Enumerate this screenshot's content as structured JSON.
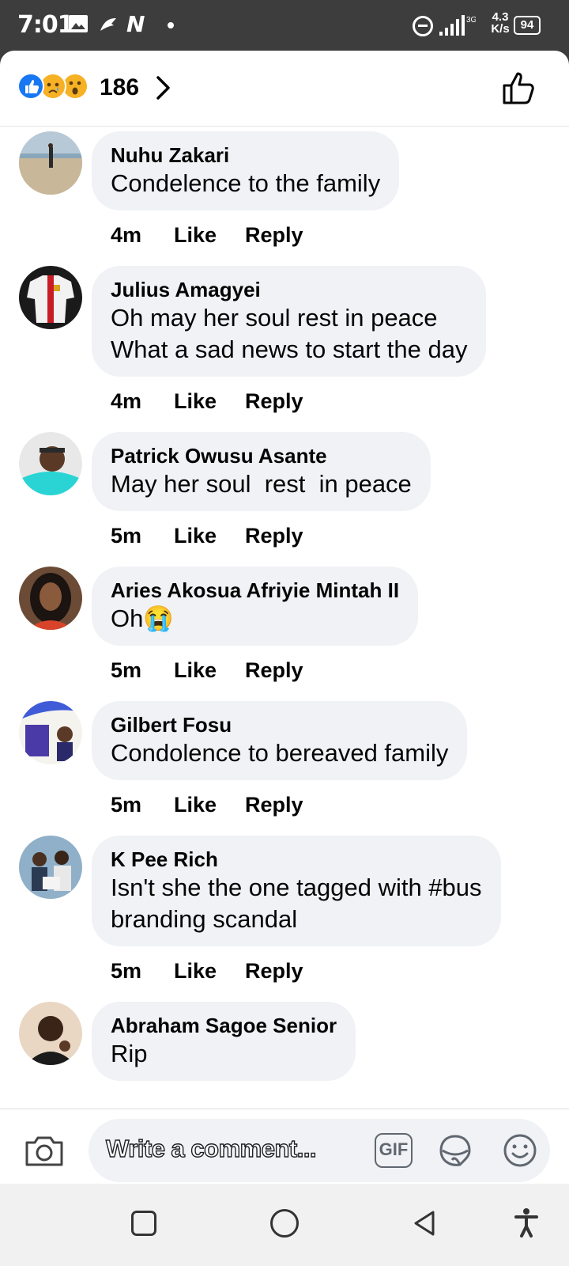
{
  "status_bar": {
    "time": "7:01",
    "n_icon": "N",
    "network_speed_value": "4.3",
    "network_speed_unit": "K/s",
    "battery": "94",
    "icons": [
      "gallery-icon",
      "arrow-icon",
      "n-icon",
      "dnd-icon",
      "signal-icon",
      "battery-icon"
    ]
  },
  "header": {
    "reaction_count": "186",
    "reactions": [
      "like",
      "sad",
      "wow"
    ]
  },
  "comments": [
    {
      "name": "Nuhu Zakari",
      "text": "Condelence to the family",
      "time": "4m",
      "like": "Like",
      "reply": "Reply"
    },
    {
      "name": "Julius Amagyei",
      "text": "Oh may her soul rest in peace\nWhat a sad news to start the day",
      "time": "4m",
      "like": "Like",
      "reply": "Reply"
    },
    {
      "name": "Patrick Owusu Asante",
      "text": "May her soul  rest  in peace",
      "time": "5m",
      "like": "Like",
      "reply": "Reply"
    },
    {
      "name": "Aries Akosua Afriyie Mintah II",
      "text": "Oh😭",
      "time": "5m",
      "like": "Like",
      "reply": "Reply"
    },
    {
      "name": "Gilbert Fosu",
      "text": "Condolence to bereaved family",
      "time": "5m",
      "like": "Like",
      "reply": "Reply"
    },
    {
      "name": "K Pee Rich",
      "text": "Isn't she the one tagged with #bus\nbranding scandal",
      "time": "5m",
      "like": "Like",
      "reply": "Reply"
    },
    {
      "name": "Abraham Sagoe Senior",
      "text": "Rip"
    }
  ],
  "composer": {
    "placeholder": "Write a comment...",
    "gif_label": "GIF"
  },
  "colors": {
    "status_bar_bg": "#3d3d3d",
    "bubble_bg": "#f0f2f5",
    "like_blue": "#1877f2",
    "reaction_yellow": "#f7b125"
  }
}
